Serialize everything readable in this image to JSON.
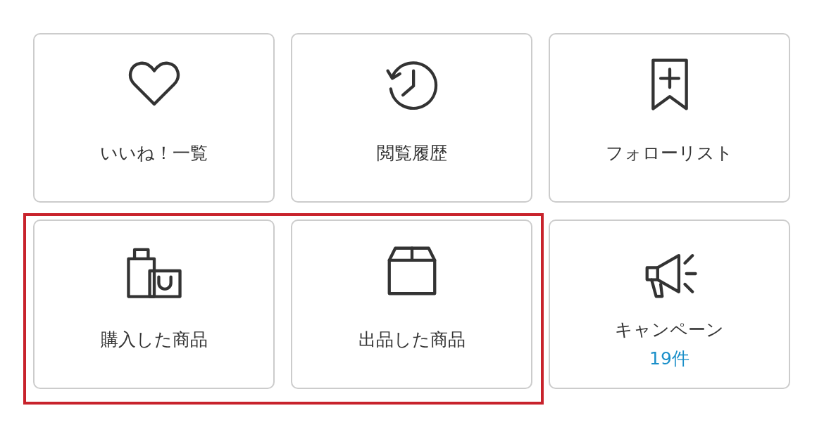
{
  "rows": [
    {
      "tiles": [
        {
          "label": "いいね！一覧",
          "highlighted": false
        },
        {
          "label": "閲覧履歴",
          "highlighted": false
        },
        {
          "label": "フォローリスト",
          "highlighted": false
        }
      ]
    },
    {
      "tiles": [
        {
          "label": "購入した商品",
          "highlighted": true
        },
        {
          "label": "出品した商品",
          "highlighted": true
        },
        {
          "label": "キャンペーン",
          "count": "19件",
          "highlighted": false
        }
      ]
    }
  ]
}
